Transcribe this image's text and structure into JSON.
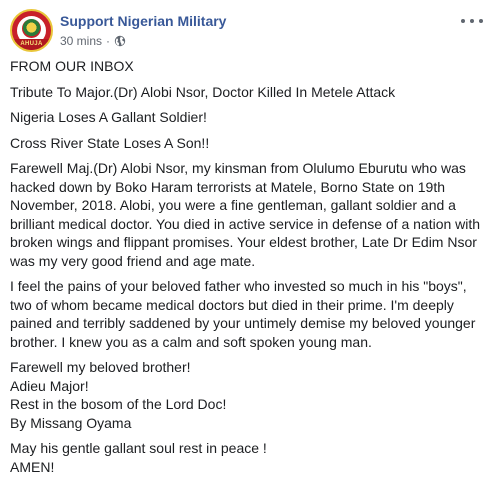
{
  "post": {
    "page_name": "Support Nigerian Military",
    "avatar_text": "AHUJA",
    "time": "30 mins",
    "separator": "·",
    "privacy_icon": "globe-icon",
    "more_icon": "more-options-icon",
    "paragraphs": [
      "FROM OUR INBOX",
      "Tribute To Major.(Dr) Alobi Nsor, Doctor Killed In Metele Attack",
      "Nigeria Loses A Gallant Soldier!",
      "Cross River State Loses A Son!!",
      "Farewell Maj.(Dr) Alobi Nsor, my kinsman from Olulumo Eburutu who was hacked down by Boko Haram terrorists at Matele, Borno State on 19th November, 2018. Alobi, you were a fine gentleman, gallant soldier and a brilliant medical doctor. You died in active service in defense of a nation with broken wings and flippant promises. Your eldest brother, Late Dr Edim Nsor was my very good friend and age mate.",
      "I feel the pains of your beloved father who invested so much in his \"boys\", two of whom became medical doctors but died in their prime. I'm deeply pained and terribly saddened by your untimely demise my beloved younger brother. I knew you as a calm and soft spoken young man."
    ],
    "closing_lines": [
      "Farewell my beloved brother!",
      "Adieu Major!",
      "Rest in the bosom of the Lord Doc!",
      "By Missang Oyama"
    ],
    "final_lines": [
      "May his gentle gallant soul rest in peace !",
      "AMEN!"
    ]
  }
}
